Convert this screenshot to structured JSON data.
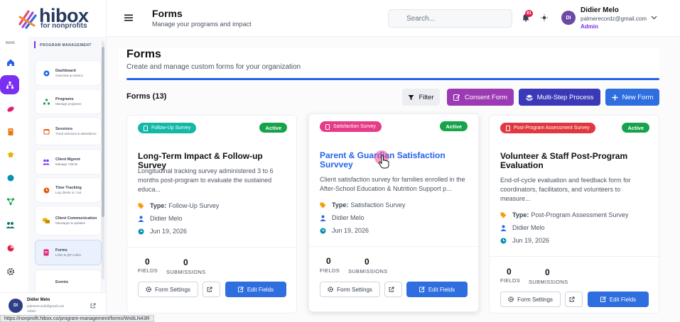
{
  "brand": {
    "name": "hibox",
    "tagline": "for nonprofits"
  },
  "header": {
    "title": "Forms",
    "subtitle": "Manage your programs and impact",
    "search_placeholder": "Search...",
    "notification_count": "81",
    "user": {
      "initials": "DI",
      "name": "Didier Melo",
      "email": "palmerecordz@gmail.com",
      "role": "Admin"
    }
  },
  "rail": {
    "label": "MAIN",
    "icons": [
      "home-icon",
      "org-chart-icon",
      "leaf-icon",
      "book-icon",
      "graduation-icon",
      "globe-icon",
      "network-icon",
      "group-icon",
      "pie-chart-icon",
      "settings-icon"
    ],
    "active_index": 1
  },
  "sidebar": {
    "section": "PROGRAM MANAGEMENT",
    "items": [
      {
        "title": "Dashboard",
        "sub": "Overview & metrics",
        "icon": "dashboard-icon"
      },
      {
        "title": "Programs",
        "sub": "Manage programs",
        "icon": "programs-icon"
      },
      {
        "title": "Sessions",
        "sub": "Track sessions & attendance",
        "icon": "sessions-icon"
      },
      {
        "title": "Client Mgmnt",
        "sub": "Manage Clients",
        "icon": "clients-icon"
      },
      {
        "title": "Time Tracking",
        "sub": "Log clients in / out",
        "icon": "clock-icon"
      },
      {
        "title": "Client Communication",
        "sub": "Messages & updates",
        "icon": "chat-icon"
      },
      {
        "title": "Forms",
        "sub": "Links & QR codes",
        "icon": "forms-icon"
      },
      {
        "title": "Events",
        "sub": "",
        "icon": "events-icon"
      }
    ],
    "active_index": 6
  },
  "footer_user": {
    "initials": "DI",
    "name": "Didier Melo",
    "email": "palmerecordz@gmail.com",
    "role": "Admin"
  },
  "page": {
    "title": "Forms",
    "subtitle": "Create and manage custom forms for your organization",
    "count_label": "Forms (13)",
    "buttons": {
      "filter": "Filter",
      "consent": "Consent Form",
      "multi": "Multi-Step Process",
      "new": "New Form"
    }
  },
  "cards": [
    {
      "category": "Follow-Up Survey",
      "category_color": "#14b8a6",
      "status": "Active",
      "title": "Long-Term Impact & Follow-up Survey",
      "description": "Longitudinal tracking survey administered 3 to 6 months post-program to evaluate the sustained educa...",
      "type_label": "Type:",
      "type_value": "Follow-Up Survey",
      "author": "Didier Melo",
      "date": "Jun 19, 2026",
      "fields": "0",
      "fields_label": "FIELDS",
      "submissions": "0",
      "submissions_label": "SUBMISSIONS",
      "settings_label": "Form Settings",
      "edit_label": "Edit Fields"
    },
    {
      "category": "Satisfaction Survey",
      "category_color": "#e63b87",
      "status": "Active",
      "title": "Parent & Guardian Satisfaction Survvey",
      "description": "Client satisfaction survey for families enrolled in the After-School Education & Nutrition Support p...",
      "type_label": "Type:",
      "type_value": "Satisfaction Survey",
      "author": "Didier Melo",
      "date": "Jun 19, 2026",
      "fields": "0",
      "fields_label": "FIELDS",
      "submissions": "0",
      "submissions_label": "SUBMISSIONS",
      "settings_label": "Form Settings",
      "edit_label": "Edit Fields"
    },
    {
      "category": "Post-Program Assessment Survey",
      "category_color": "#e0383e",
      "status": "Active",
      "title": "Volunteer & Staff Post-Program Evaluation",
      "description": "End-of-cycle evaluation and feedback form for coordinators, facilitators, and volunteers to measure...",
      "type_label": "Type:",
      "type_value": "Post-Program Assessment Survey",
      "author": "Didier Melo",
      "date": "Jun 19, 2026",
      "fields": "0",
      "fields_label": "FIELDS",
      "submissions": "0",
      "submissions_label": "SUBMISSIONS",
      "settings_label": "Form Settings",
      "edit_label": "Edit Fields"
    }
  ],
  "status_url": "https://nonprofit.hibox.co/program-management/forms/Wx8LN43R",
  "colors": {
    "primary": "#2f6ede",
    "purple": "#7b2ff2",
    "consent": "#9b3ab3",
    "multi": "#3b39b8",
    "active": "#16a34a"
  }
}
